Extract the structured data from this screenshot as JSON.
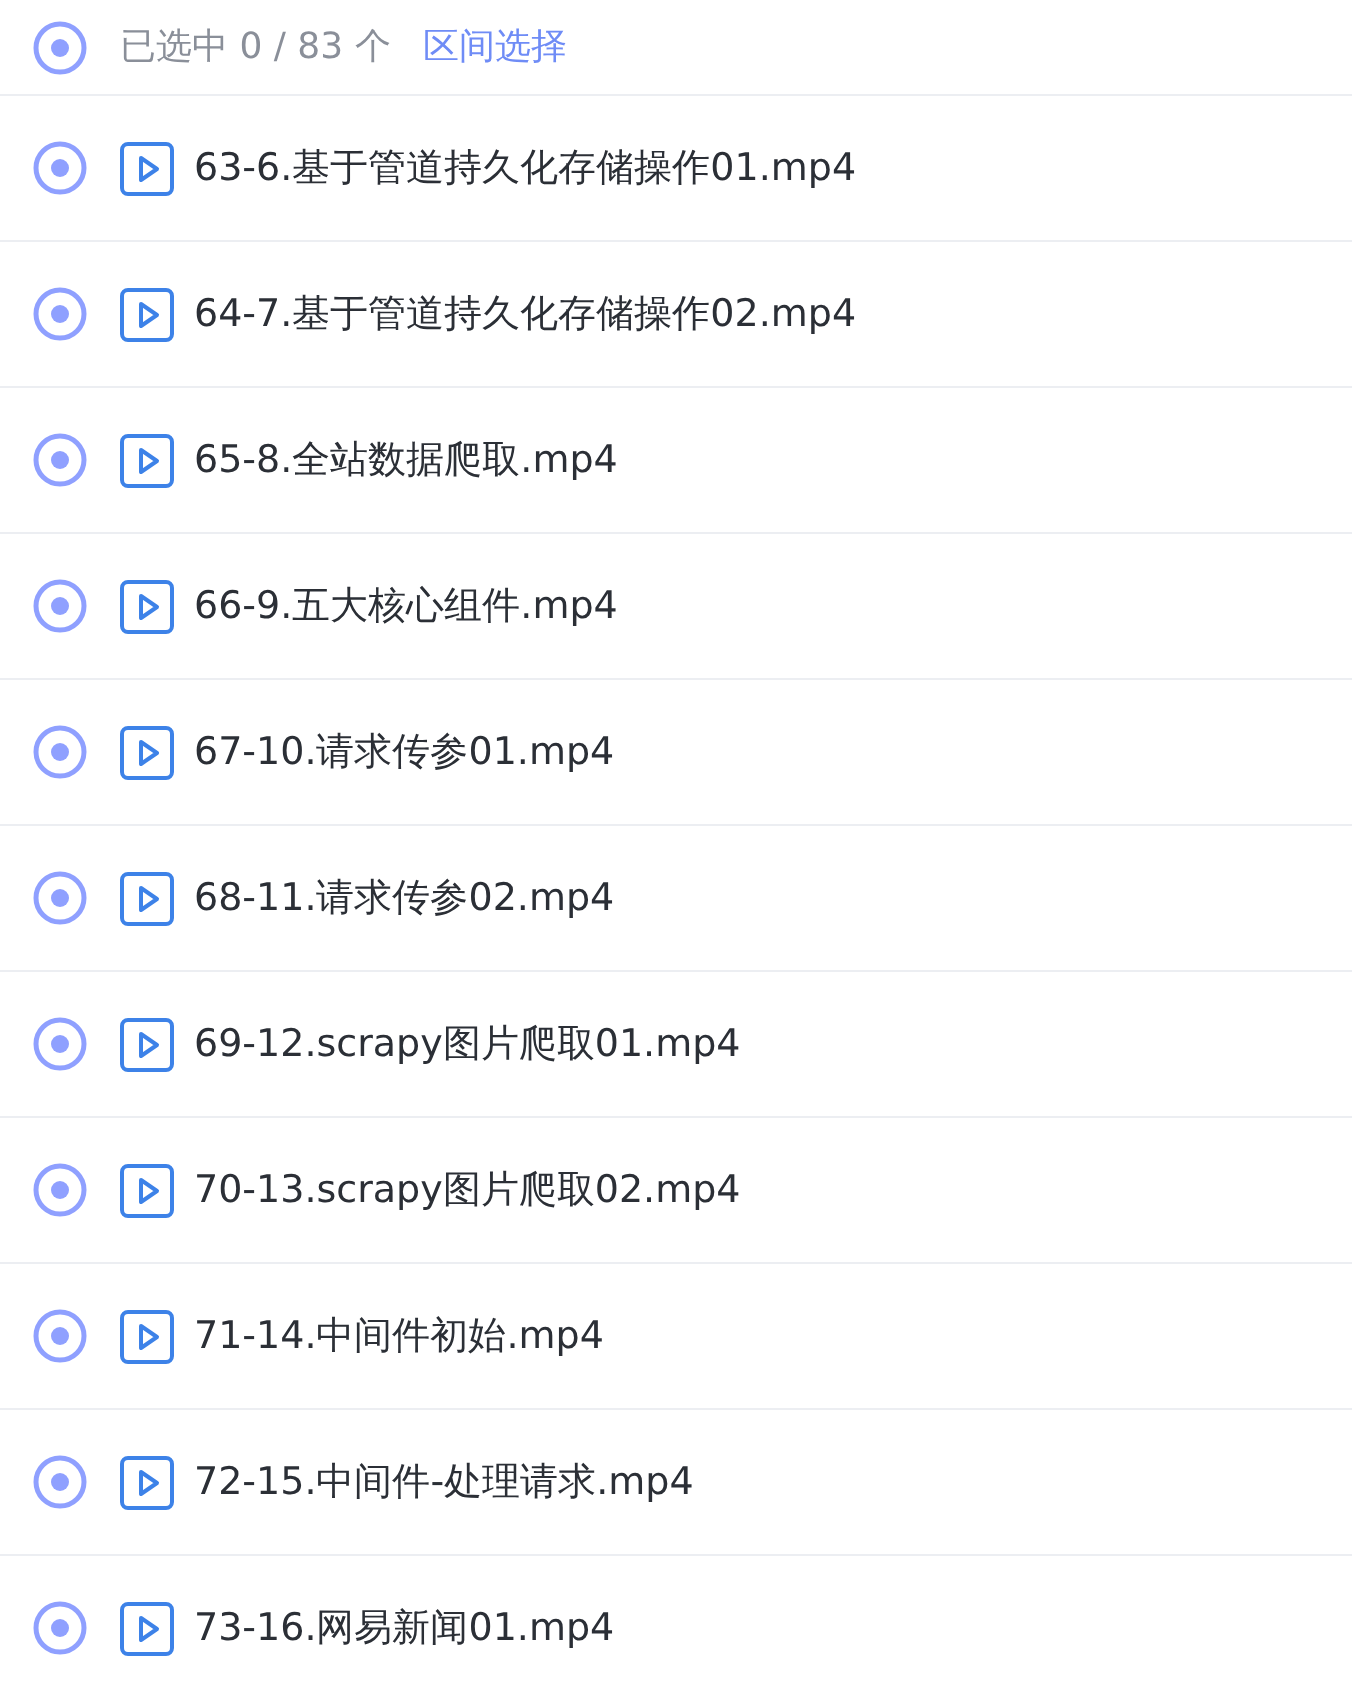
{
  "header": {
    "selected": false,
    "count_text": "已选中 0 / 83 个",
    "range_link": "区间选择"
  },
  "files": [
    {
      "name": "63-6.基于管道持久化存储操作01.mp4",
      "selected": false
    },
    {
      "name": "64-7.基于管道持久化存储操作02.mp4",
      "selected": false
    },
    {
      "name": "65-8.全站数据爬取.mp4",
      "selected": false
    },
    {
      "name": "66-9.五大核心组件.mp4",
      "selected": false
    },
    {
      "name": "67-10.请求传参01.mp4",
      "selected": false
    },
    {
      "name": "68-11.请求传参02.mp4",
      "selected": false
    },
    {
      "name": "69-12.scrapy图片爬取01.mp4",
      "selected": false
    },
    {
      "name": "70-13.scrapy图片爬取02.mp4",
      "selected": false
    },
    {
      "name": "71-14.中间件初始.mp4",
      "selected": false
    },
    {
      "name": "72-15.中间件-处理请求.mp4",
      "selected": false
    },
    {
      "name": "73-16.网易新闻01.mp4",
      "selected": false
    }
  ]
}
